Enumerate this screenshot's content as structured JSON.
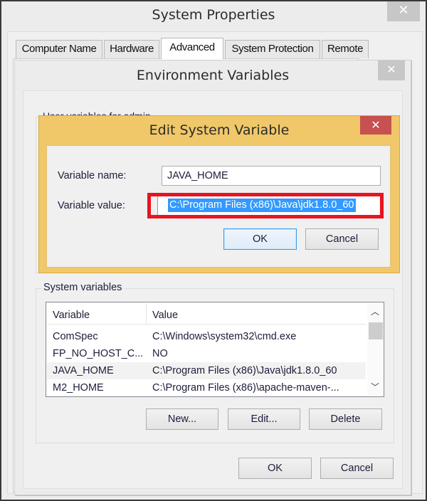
{
  "system_properties": {
    "title": "System Properties",
    "close_icon": "close-icon",
    "tabs": [
      {
        "label": "Computer Name",
        "active": false
      },
      {
        "label": "Hardware",
        "active": false
      },
      {
        "label": "Advanced",
        "active": true
      },
      {
        "label": "System Protection",
        "active": false
      },
      {
        "label": "Remote",
        "active": false
      }
    ]
  },
  "environment_variables": {
    "title": "Environment Variables",
    "close_icon": "close-icon",
    "user_variables_label": "User variables for admin",
    "system_variables": {
      "label": "System variables",
      "columns": [
        "Variable",
        "Value"
      ],
      "rows": [
        {
          "variable": "ComSpec",
          "value": "C:\\Windows\\system32\\cmd.exe"
        },
        {
          "variable": "FP_NO_HOST_C...",
          "value": "NO"
        },
        {
          "variable": "JAVA_HOME",
          "value": "C:\\Program Files (x86)\\Java\\jdk1.8.0_60",
          "highlighted": true
        },
        {
          "variable": "M2_HOME",
          "value": "C:\\Program Files (x86)\\apache-maven-..."
        }
      ],
      "scroll_up_icon": "chevron-up-icon",
      "scroll_down_icon": "chevron-down-icon",
      "buttons": {
        "new": "New...",
        "edit": "Edit...",
        "delete": "Delete"
      }
    },
    "buttons": {
      "ok": "OK",
      "cancel": "Cancel"
    }
  },
  "edit_system_variable": {
    "title": "Edit System Variable",
    "close_icon": "close-icon",
    "variable_name_label": "Variable name:",
    "variable_name_value": "JAVA_HOME",
    "variable_value_label": "Variable value:",
    "variable_value": "C:\\Program Files (x86)\\Java\\jdk1.8.0_60",
    "buttons": {
      "ok": "OK",
      "cancel": "Cancel"
    },
    "highlight_color": "#e8141f",
    "selection_color": "#3399ff",
    "title_bar_color": "#f0c869",
    "close_button_color": "#c75050"
  }
}
